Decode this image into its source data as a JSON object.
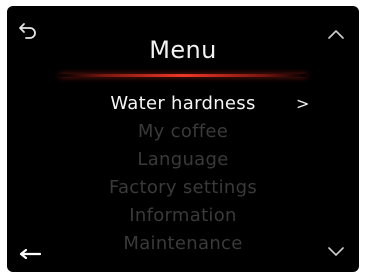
{
  "screen": {
    "title": "Menu",
    "icons": {
      "back": "back-curved-arrow-icon",
      "scroll_up": "chevron-up-icon",
      "scroll_down": "chevron-down-icon",
      "left": "left-arrow-icon",
      "submenu": "chevron-right-icon"
    },
    "selected_indicator": ">",
    "items": [
      {
        "label": "Water hardness",
        "selected": true
      },
      {
        "label": "My coffee",
        "selected": false
      },
      {
        "label": "Language",
        "selected": false
      },
      {
        "label": "Factory settings",
        "selected": false
      },
      {
        "label": "Information",
        "selected": false
      },
      {
        "label": "Maintenance",
        "selected": false
      }
    ]
  },
  "colors": {
    "background": "#000000",
    "text_selected": "#f5f5f5",
    "text_dim": "#3a3a3a",
    "accent_divider": "#f03728"
  }
}
